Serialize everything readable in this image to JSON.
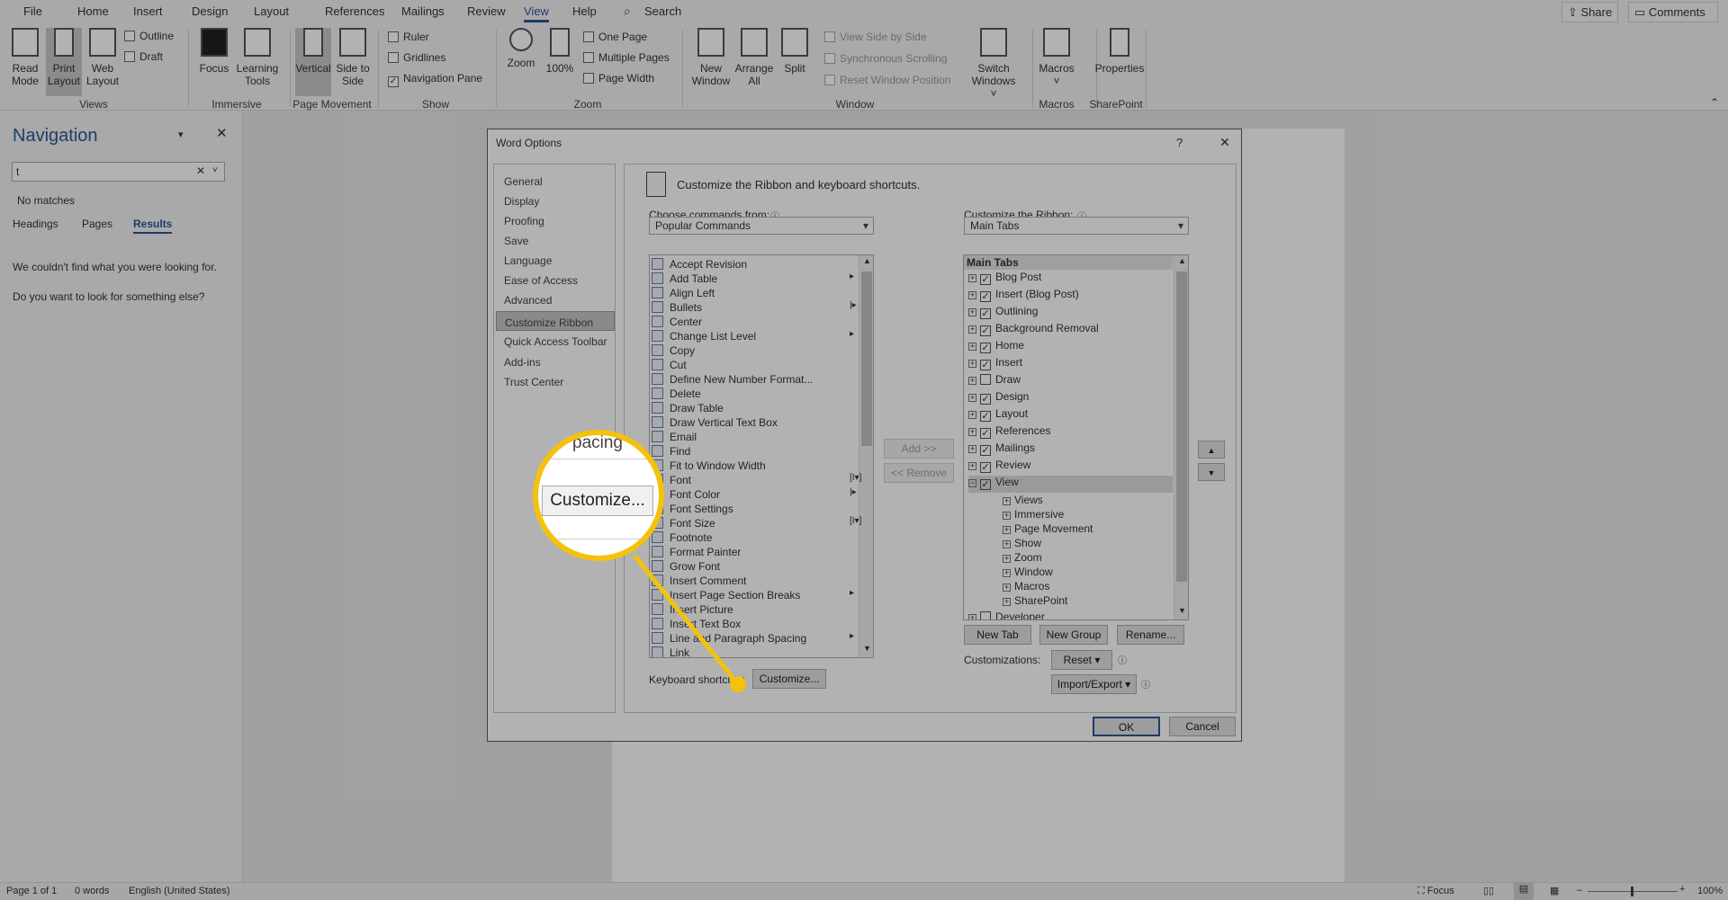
{
  "tabs": [
    "File",
    "Home",
    "Insert",
    "Design",
    "Layout",
    "References",
    "Mailings",
    "Review",
    "View",
    "Help"
  ],
  "active_tab": "View",
  "search": "Search",
  "share": "Share",
  "comments": "Comments",
  "ribbon": {
    "read_mode": "Read Mode",
    "print_layout": "Print Layout",
    "web_layout": "Web Layout",
    "outline": "Outline",
    "draft": "Draft",
    "focus": "Focus",
    "learning_tools": "Learning Tools",
    "vertical": "Vertical",
    "side_to_side": "Side to Side",
    "ruler": "Ruler",
    "gridlines": "Gridlines",
    "navigation_pane": "Navigation Pane",
    "zoom": "Zoom",
    "zoom100": "100%",
    "one_page": "One Page",
    "multiple_pages": "Multiple Pages",
    "page_width": "Page Width",
    "new_window": "New Window",
    "arrange_all": "Arrange All",
    "split": "Split",
    "view_side_by_side": "View Side by Side",
    "synchronous_scrolling": "Synchronous Scrolling",
    "reset_window_position": "Reset Window Position",
    "switch_windows": "Switch Windows",
    "macros": "Macros",
    "properties": "Properties",
    "groups": [
      "Views",
      "Immersive",
      "Page Movement",
      "Show",
      "Zoom",
      "Window",
      "Macros",
      "SharePoint"
    ],
    "ruler_checked": false,
    "gridlines_checked": false,
    "navigation_pane_checked": true
  },
  "nav": {
    "title": "Navigation",
    "search_value": "t",
    "no_matches": "No matches",
    "tabs": [
      "Headings",
      "Pages",
      "Results"
    ],
    "active_tab": "Results",
    "msg1": "We couldn't find what you were looking for.",
    "msg2": "Do you want to look for something else?"
  },
  "status": {
    "page": "Page 1 of 1",
    "words": "0 words",
    "language": "English (United States)",
    "focus": "Focus",
    "zoom": "100%"
  },
  "dialog": {
    "title": "Word Options",
    "help": "?",
    "close": "✕",
    "sidebar": [
      "General",
      "Display",
      "Proofing",
      "Save",
      "Language",
      "Ease of Access",
      "Advanced",
      "Customize Ribbon",
      "Quick Access Toolbar",
      "Add-ins",
      "Trust Center"
    ],
    "selected": "Customize Ribbon",
    "header": "Customize the Ribbon and keyboard shortcuts.",
    "choose_label": "Choose commands from:",
    "choose_value": "Popular Commands",
    "ribbon_label": "Customize the Ribbon:",
    "ribbon_value": "Main Tabs",
    "commands": [
      {
        "label": "Accept Revision"
      },
      {
        "label": "Add Table",
        "sub": "▸"
      },
      {
        "label": "Align Left"
      },
      {
        "label": "Bullets",
        "sub": "|▸"
      },
      {
        "label": "Center"
      },
      {
        "label": "Change List Level",
        "sub": "▸"
      },
      {
        "label": "Copy"
      },
      {
        "label": "Cut"
      },
      {
        "label": "Define New Number Format..."
      },
      {
        "label": "Delete"
      },
      {
        "label": "Draw Table"
      },
      {
        "label": "Draw Vertical Text Box"
      },
      {
        "label": "Email"
      },
      {
        "label": "Find"
      },
      {
        "label": "Fit to Window Width"
      },
      {
        "label": "Font",
        "sub": "[I▾]"
      },
      {
        "label": "Font Color",
        "sub": "|▸"
      },
      {
        "label": "Font Settings"
      },
      {
        "label": "Font Size",
        "sub": "[I▾]"
      },
      {
        "label": "Footnote"
      },
      {
        "label": "Format Painter"
      },
      {
        "label": "Grow Font"
      },
      {
        "label": "Insert Comment"
      },
      {
        "label": "Insert Page  Section Breaks",
        "sub": "▸"
      },
      {
        "label": "Insert Picture"
      },
      {
        "label": "Insert Text Box"
      },
      {
        "label": "Line and Paragraph Spacing",
        "sub": "▸"
      },
      {
        "label": "Link"
      }
    ],
    "add": "Add >>",
    "remove": "<< Remove",
    "tree_header": "Main Tabs",
    "tree": [
      {
        "label": "Blog Post",
        "checked": true
      },
      {
        "label": "Insert (Blog Post)",
        "checked": true
      },
      {
        "label": "Outlining",
        "checked": true
      },
      {
        "label": "Background Removal",
        "checked": true
      },
      {
        "label": "Home",
        "checked": true
      },
      {
        "label": "Insert",
        "checked": true
      },
      {
        "label": "Draw",
        "checked": false
      },
      {
        "label": "Design",
        "checked": true
      },
      {
        "label": "Layout",
        "checked": true
      },
      {
        "label": "References",
        "checked": true
      },
      {
        "label": "Mailings",
        "checked": true
      },
      {
        "label": "Review",
        "checked": true
      },
      {
        "label": "View",
        "checked": true,
        "expanded": true
      }
    ],
    "view_groups": [
      "Views",
      "Immersive",
      "Page Movement",
      "Show",
      "Zoom",
      "Window",
      "Macros",
      "SharePoint"
    ],
    "tree_last": {
      "label": "Developer",
      "checked": false
    },
    "new_tab": "New Tab",
    "new_group": "New Group",
    "rename": "Rename...",
    "customizations": "Customizations:",
    "reset": "Reset ▾",
    "import_export": "Import/Export ▾",
    "keyboard": "Keyboard shortcuts:",
    "customize": "Customize...",
    "ok": "OK",
    "cancel": "Cancel",
    "magnifier_text": "pacing"
  },
  "colors": {
    "accent": "#2b579a",
    "highlight": "#f4c20d"
  }
}
